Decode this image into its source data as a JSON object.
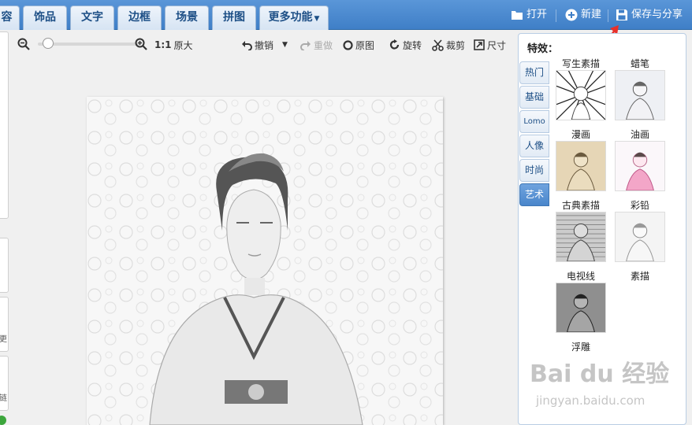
{
  "tabs": [
    {
      "label": "容"
    },
    {
      "label": "饰品"
    },
    {
      "label": "文字"
    },
    {
      "label": "边框"
    },
    {
      "label": "场景"
    },
    {
      "label": "拼图"
    },
    {
      "label": "更多功能"
    }
  ],
  "top_actions": {
    "open_label": "打开",
    "new_label": "新建",
    "save_label": "保存与分享"
  },
  "left_strip": {
    "labels": [
      "更",
      "链"
    ]
  },
  "toolbar": {
    "ratio_label": "1:1",
    "original_size_label": "原大",
    "undo_label": "撤销",
    "redo_label": "重做",
    "original_label": "原图",
    "rotate_label": "旋转",
    "crop_label": "裁剪",
    "size_label": "尺寸"
  },
  "zoom": {
    "level": 0.1
  },
  "effects_panel": {
    "title": "特效：",
    "categories": [
      {
        "label": "热门"
      },
      {
        "label": "基础"
      },
      {
        "label": "Lomo"
      },
      {
        "label": "人像"
      },
      {
        "label": "时尚"
      },
      {
        "label": "艺术",
        "active": true
      }
    ],
    "effects": [
      {
        "label": "写生素描"
      },
      {
        "label": "蜡笔"
      },
      {
        "label": "漫画"
      },
      {
        "label": "油画"
      },
      {
        "label": "古典素描"
      },
      {
        "label": "彩铅"
      },
      {
        "label": "电视线"
      },
      {
        "label": "素描"
      },
      {
        "label": "浮雕"
      }
    ]
  },
  "watermark": {
    "brand": "Bai du 经验",
    "url": "jingyan.baidu.com"
  },
  "colors": {
    "topbar": "#4a8ad0",
    "tab_text": "#1d4f86",
    "active_category": "#4a86cb",
    "arrow": "#e8302a"
  }
}
